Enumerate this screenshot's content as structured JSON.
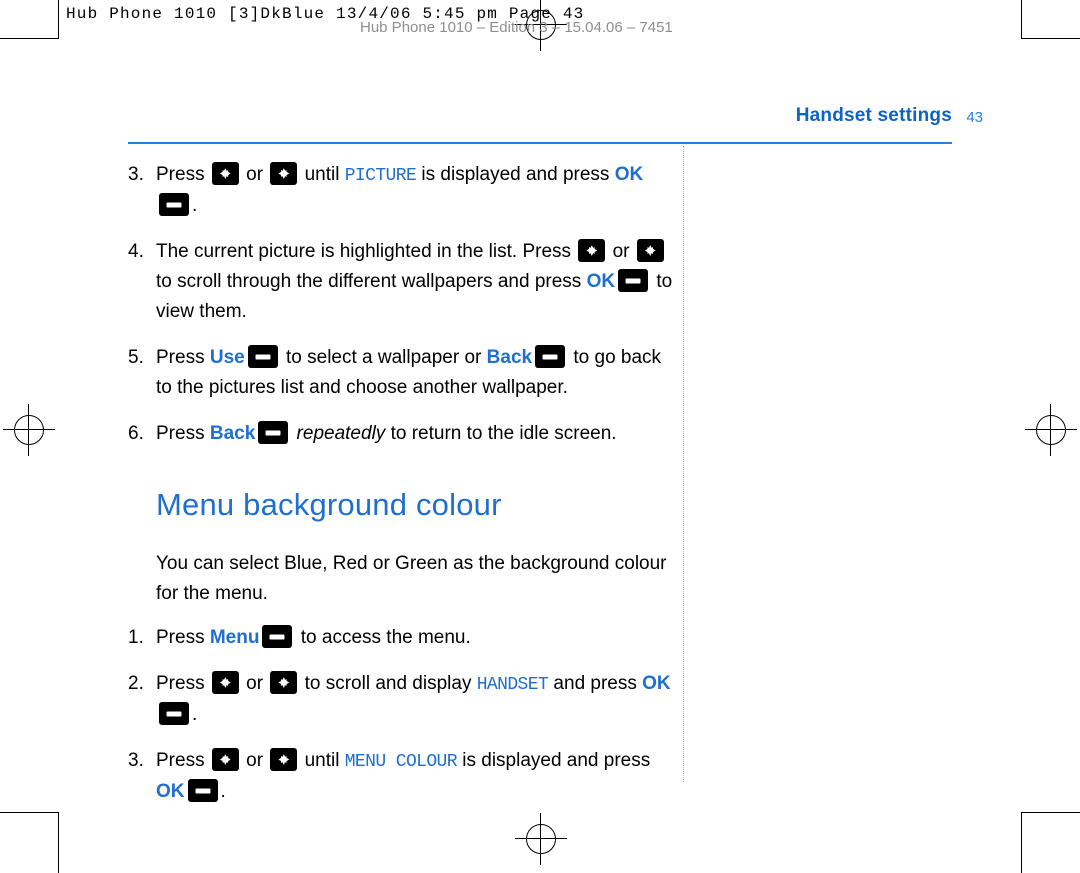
{
  "printer_slug": "Hub Phone 1010 [3]DkBlue  13/4/06  5:45 pm  Page 43",
  "ghost_header": "Hub Phone 1010 – Edition 3 – 15.04.06 – 7451",
  "header": {
    "running_head": "Handset settings",
    "folio": "43"
  },
  "steps_top": [
    {
      "num": "3.",
      "parts": [
        {
          "t": "text",
          "v": "Press "
        },
        {
          "t": "navkey"
        },
        {
          "t": "text",
          "v": " or "
        },
        {
          "t": "navkey"
        },
        {
          "t": "text",
          "v": " until "
        },
        {
          "t": "lcd",
          "v": "PICTURE"
        },
        {
          "t": "text",
          "v": " is displayed and press "
        },
        {
          "t": "kw",
          "v": "OK"
        },
        {
          "t": "softkey"
        },
        {
          "t": "text",
          "v": "."
        }
      ]
    },
    {
      "num": "4.",
      "parts": [
        {
          "t": "text",
          "v": "The current picture is highlighted in the list. Press "
        },
        {
          "t": "navkey"
        },
        {
          "t": "text",
          "v": " or "
        },
        {
          "t": "navkey"
        },
        {
          "t": "text",
          "v": " to scroll through the different wallpapers and press "
        },
        {
          "t": "kw",
          "v": "OK"
        },
        {
          "t": "softkey"
        },
        {
          "t": "text",
          "v": " to view them."
        }
      ]
    },
    {
      "num": "5.",
      "parts": [
        {
          "t": "text",
          "v": "Press "
        },
        {
          "t": "kw",
          "v": "Use"
        },
        {
          "t": "softkey"
        },
        {
          "t": "text",
          "v": " to select a wallpaper or "
        },
        {
          "t": "kw",
          "v": "Back"
        },
        {
          "t": "softkey"
        },
        {
          "t": "text",
          "v": " to go back to the pictures list and choose another wallpaper."
        }
      ]
    },
    {
      "num": "6.",
      "parts": [
        {
          "t": "text",
          "v": "Press "
        },
        {
          "t": "kw",
          "v": "Back"
        },
        {
          "t": "softkey"
        },
        {
          "t": "ital",
          "v": " repeatedly"
        },
        {
          "t": "text",
          "v": " to return to the idle screen."
        }
      ]
    }
  ],
  "section": {
    "title": "Menu background colour",
    "intro": "You can select Blue, Red or Green as the background colour for the menu."
  },
  "steps_bottom": [
    {
      "num": "1.",
      "parts": [
        {
          "t": "text",
          "v": "Press "
        },
        {
          "t": "kw",
          "v": "Menu"
        },
        {
          "t": "softkey"
        },
        {
          "t": "text",
          "v": " to access the menu."
        }
      ]
    },
    {
      "num": "2.",
      "parts": [
        {
          "t": "text",
          "v": "Press "
        },
        {
          "t": "navkey"
        },
        {
          "t": "text",
          "v": " or "
        },
        {
          "t": "navkey"
        },
        {
          "t": "text",
          "v": " to scroll and display "
        },
        {
          "t": "lcd",
          "v": "HANDSET"
        },
        {
          "t": "text",
          "v": " and press "
        },
        {
          "t": "kw",
          "v": "OK"
        },
        {
          "t": "softkey"
        },
        {
          "t": "text",
          "v": "."
        }
      ]
    },
    {
      "num": "3.",
      "parts": [
        {
          "t": "text",
          "v": "Press "
        },
        {
          "t": "navkey"
        },
        {
          "t": "text",
          "v": " or "
        },
        {
          "t": "navkey"
        },
        {
          "t": "text",
          "v": " until "
        },
        {
          "t": "lcd",
          "v": "MENU COLOUR"
        },
        {
          "t": "text",
          "v": " is displayed and press "
        },
        {
          "t": "kw",
          "v": "OK"
        },
        {
          "t": "softkey"
        },
        {
          "t": "text",
          "v": "."
        }
      ]
    }
  ],
  "colors": {
    "accent_blue": "#1f6fd0",
    "head_blue": "#0b63c7",
    "rule_blue": "#2a7de1",
    "key_black": "#000000",
    "ghost_grey": "#8e8e8e"
  }
}
